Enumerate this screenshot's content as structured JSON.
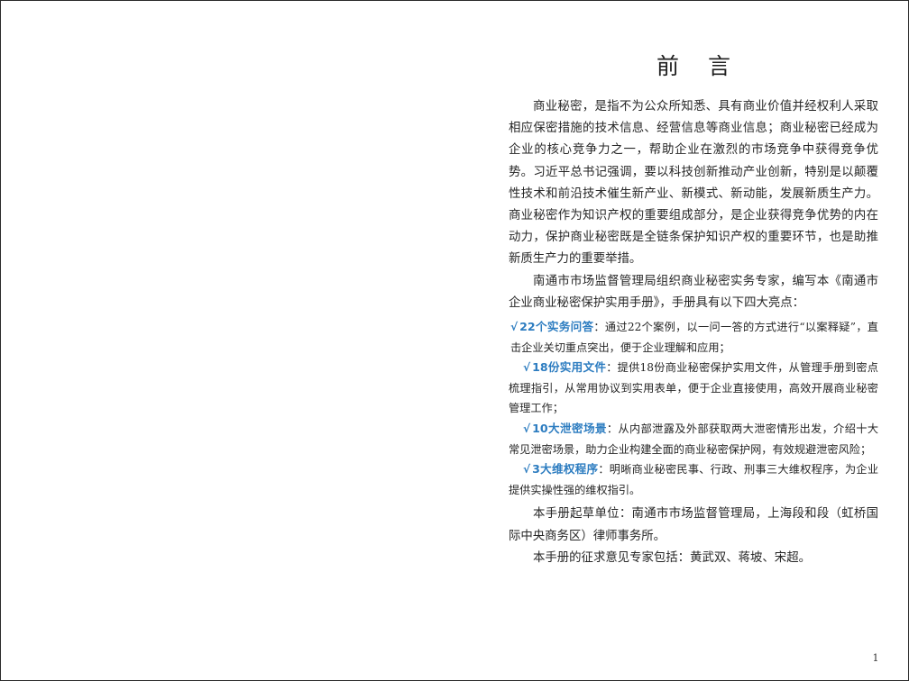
{
  "page": {
    "title": "前 言",
    "page_number": "1"
  },
  "paragraphs": [
    "商业秘密，是指不为公众所知悉、具有商业价值并经权利人采取相应保密措施的技术信息、经营信息等商业信息；商业秘密已经成为企业的核心竞争力之一，帮助企业在激烈的市场竞争中获得竞争优势。习近平总书记强调，要以科技创新推动产业创新，特别是以颠覆性技术和前沿技术催生新产业、新模式、新动能，发展新质生产力。商业秘密作为知识产权的重要组成部分，是企业获得竞争优势的内在动力，保护商业秘密既是全链条保护知识产权的重要环节，也是助推新质生产力的重要举措。",
    "南通市市场监督管理局组织商业秘密实务专家，编写本《南通市企业商业秘密保护实用手册》，手册具有以下四大亮点："
  ],
  "highlights": [
    {
      "check": "√",
      "label": "22个实务问答",
      "text": "：通过22个案例，以一问一答的方式进行“以案释疑”，直击企业关切重点突出，便于企业理解和应用；"
    },
    {
      "check": "√",
      "label": "18份实用文件",
      "text": "：提供18份商业秘密保护实用文件，从管理手册到密点梳理指引，从常用协议到实用表单，便于企业直接使用，高效开展商业秘密管理工作；"
    },
    {
      "check": "√",
      "label": "10大泄密场景",
      "text": "：从内部泄露及外部获取两大泄密情形出发，介绍十大常见泄密场景，助力企业构建全面的商业秘密保护网，有效规避泄密风险；"
    },
    {
      "check": "√",
      "label": "3大维权程序",
      "text": "：明晰商业秘密民事、行政、刑事三大维权程序，为企业提供实操性强的维权指引。"
    }
  ],
  "closing": [
    "本手册起草单位：南通市市场监督管理局，上海段和段（虹桥国际中央商务区）律师事务所。",
    "本手册的征求意见专家包括：黄武双、蒋坡、宋超。"
  ],
  "colors": {
    "accent": "#2c7cc0",
    "text": "#262626",
    "border": "#2a2a2a"
  }
}
